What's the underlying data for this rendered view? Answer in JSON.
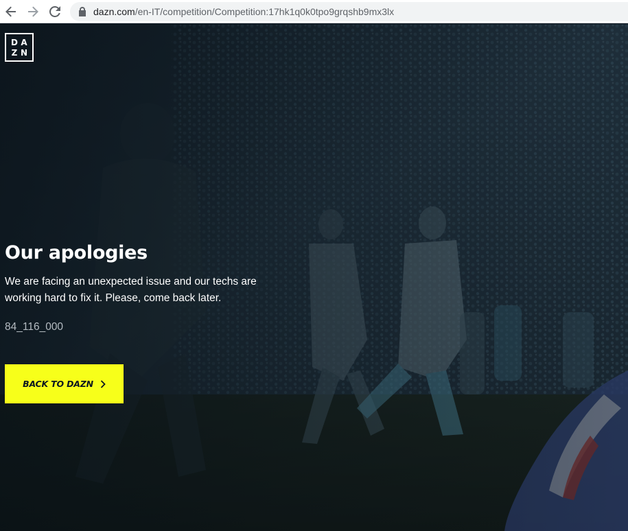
{
  "browser": {
    "url_host": "dazn.com",
    "url_path": "/en-IT/competition/Competition:17hk1q0k0tpo9grqshb9mx3lx",
    "back_icon": "arrow-left-icon",
    "forward_icon": "arrow-right-icon",
    "reload_icon": "reload-icon",
    "lock_icon": "lock-icon"
  },
  "logo": {
    "letters": [
      "D",
      "A",
      "Z",
      "N"
    ]
  },
  "error": {
    "title": "Our apologies",
    "message": "We are facing an unexpected issue and our techs are working hard to fix it. Please, come back later.",
    "code": "84_116_000"
  },
  "cta": {
    "label": "BACK TO DAZN",
    "icon": "chevron-right-icon",
    "color": "#f7ff1a"
  },
  "colors": {
    "background": "#0d1821",
    "text": "#ffffff",
    "muted_text": "#b5bcc2"
  }
}
